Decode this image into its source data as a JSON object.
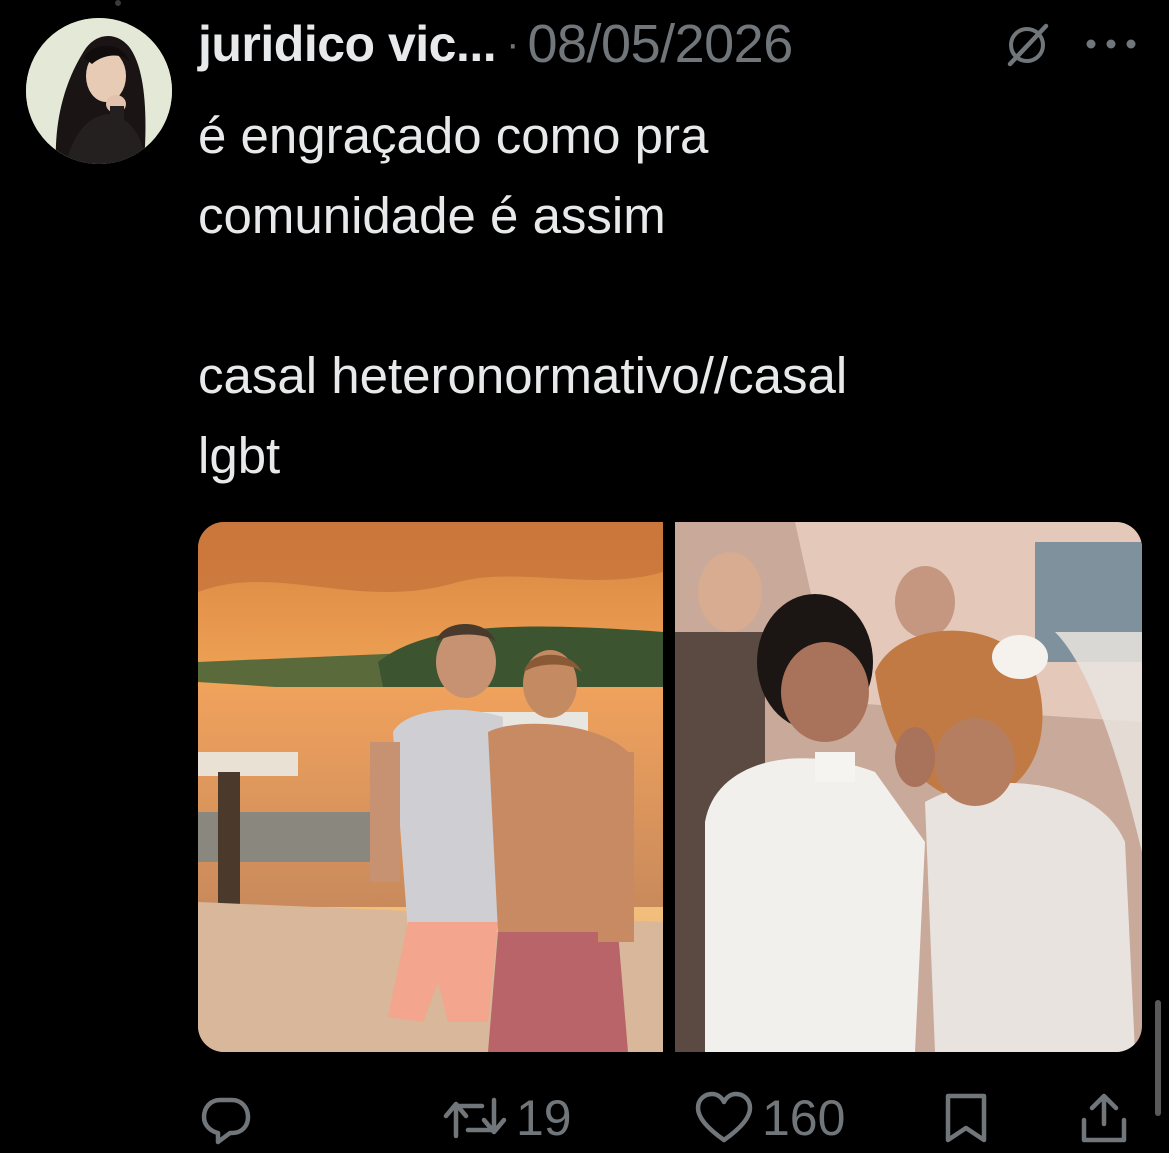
{
  "author": {
    "display_name": "juridico vic...",
    "separator": "·",
    "date": "08/05/2026",
    "avatar_icon": "profile-avatar"
  },
  "header_icons": {
    "grok": "grok-icon",
    "more": "more-icon"
  },
  "tweet": {
    "text": "é engraçado como pra\ncomunidade é assim\n\ncasal heteronormativo//casal\nlgbt"
  },
  "media": [
    {
      "name": "photo-left",
      "description_icon": "image"
    },
    {
      "name": "photo-right",
      "description_icon": "image"
    }
  ],
  "actions": {
    "reply_icon": "reply-icon",
    "retweet_icon": "retweet-icon",
    "retweet_count": "19",
    "like_icon": "heart-icon",
    "like_count": "160",
    "bookmark_icon": "bookmark-icon",
    "share_icon": "share-icon"
  },
  "colors": {
    "background": "#000000",
    "text_primary": "#e7e9ea",
    "text_secondary": "#71767b"
  }
}
